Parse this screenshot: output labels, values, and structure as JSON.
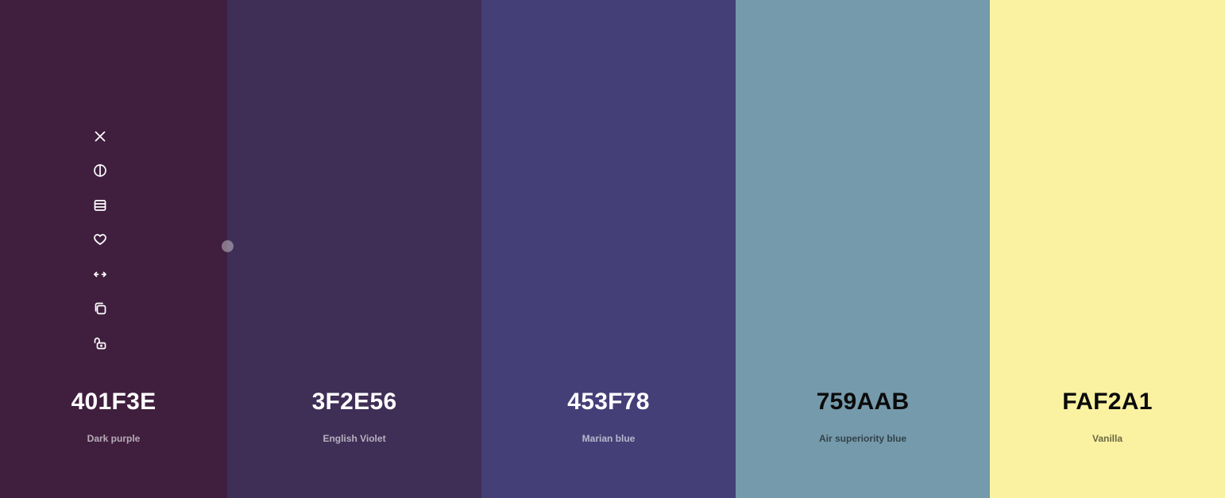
{
  "swatches": [
    {
      "hex": "401F3E",
      "name": "Dark purple",
      "color": "#401F3E",
      "text_tone": "light"
    },
    {
      "hex": "3F2E56",
      "name": "English Violet",
      "color": "#3F2E56",
      "text_tone": "light"
    },
    {
      "hex": "453F78",
      "name": "Marian blue",
      "color": "#453F78",
      "text_tone": "light"
    },
    {
      "hex": "759AAB",
      "name": "Air superiority blue",
      "color": "#759AAB",
      "text_tone": "dark"
    },
    {
      "hex": "FAF2A1",
      "name": "Vanilla",
      "color": "#FAF2A1",
      "text_tone": "dark"
    }
  ],
  "toolbar": {
    "icons": [
      "close-icon",
      "contrast-icon",
      "shades-icon",
      "heart-icon",
      "drag-arrows-icon",
      "copy-icon",
      "unlock-icon"
    ]
  }
}
